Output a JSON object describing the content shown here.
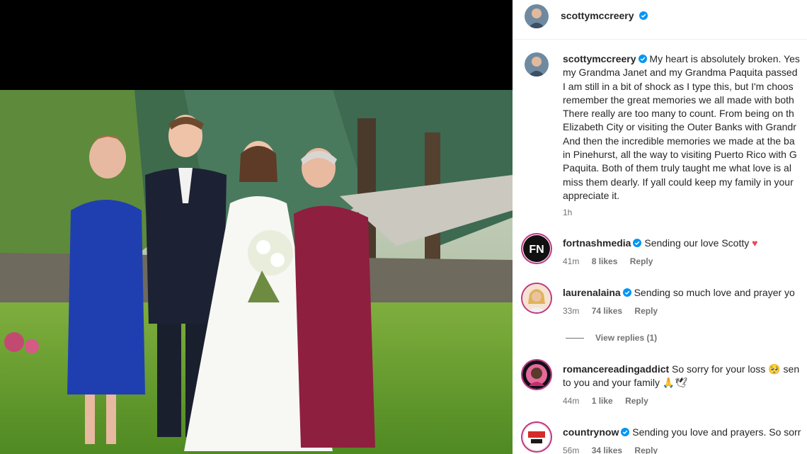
{
  "post": {
    "username": "scottymccreery",
    "caption_lines": [
      "My heart is absolutely broken. Yes",
      "my Grandma Janet and my Grandma Paquita passed",
      "I am still in a bit of shock as I type this, but I'm choos",
      "remember the great memories we all made with both",
      "There really are too many to count. From being on th",
      "Elizabeth City or visiting the Outer Banks with Grandr",
      "And then the incredible memories we made at the ba",
      "in Pinehurst, all the way to visiting Puerto Rico with G",
      "Paquita. Both of them truly taught me what love is al",
      "miss them dearly. If yall could keep my family in your",
      "appreciate it."
    ],
    "time": "1h"
  },
  "comments": [
    {
      "username": "fortnashmedia",
      "text": "Sending our love Scotty ",
      "emoji": "♥",
      "time": "41m",
      "likes": "8 likes",
      "reply": "Reply"
    },
    {
      "username": "laurenalaina",
      "text": "Sending so much love and prayer yo",
      "time": "33m",
      "likes": "74 likes",
      "reply": "Reply"
    },
    {
      "username": "romancereadingaddict",
      "text": "So sorry for your loss ",
      "emoji": "🥺",
      "text_after": " sen",
      "line2": "to you and your family 🙏🕊",
      "time": "44m",
      "likes": "1 like",
      "reply": "Reply"
    },
    {
      "username": "countrynow",
      "text": "Sending you love and prayers. So sorr",
      "time": "56m",
      "likes": "34 likes",
      "reply": "Reply"
    }
  ],
  "view_replies": "View replies (1)",
  "icons": {
    "verified": "verified-badge-icon"
  },
  "colors": {
    "verified_blue": "#0095f6",
    "muted": "#737373",
    "heart": "#ed4956"
  }
}
